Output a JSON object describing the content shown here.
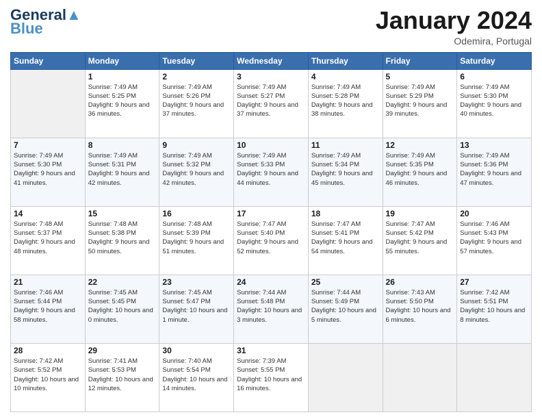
{
  "header": {
    "logo_general": "General",
    "logo_blue": "Blue",
    "month_title": "January 2024",
    "location": "Odemira, Portugal"
  },
  "days_of_week": [
    "Sunday",
    "Monday",
    "Tuesday",
    "Wednesday",
    "Thursday",
    "Friday",
    "Saturday"
  ],
  "weeks": [
    [
      {
        "day": "",
        "sunrise": "",
        "sunset": "",
        "daylight": ""
      },
      {
        "day": "1",
        "sunrise": "Sunrise: 7:49 AM",
        "sunset": "Sunset: 5:25 PM",
        "daylight": "Daylight: 9 hours and 36 minutes."
      },
      {
        "day": "2",
        "sunrise": "Sunrise: 7:49 AM",
        "sunset": "Sunset: 5:26 PM",
        "daylight": "Daylight: 9 hours and 37 minutes."
      },
      {
        "day": "3",
        "sunrise": "Sunrise: 7:49 AM",
        "sunset": "Sunset: 5:27 PM",
        "daylight": "Daylight: 9 hours and 37 minutes."
      },
      {
        "day": "4",
        "sunrise": "Sunrise: 7:49 AM",
        "sunset": "Sunset: 5:28 PM",
        "daylight": "Daylight: 9 hours and 38 minutes."
      },
      {
        "day": "5",
        "sunrise": "Sunrise: 7:49 AM",
        "sunset": "Sunset: 5:29 PM",
        "daylight": "Daylight: 9 hours and 39 minutes."
      },
      {
        "day": "6",
        "sunrise": "Sunrise: 7:49 AM",
        "sunset": "Sunset: 5:30 PM",
        "daylight": "Daylight: 9 hours and 40 minutes."
      }
    ],
    [
      {
        "day": "7",
        "sunrise": "Sunrise: 7:49 AM",
        "sunset": "Sunset: 5:30 PM",
        "daylight": "Daylight: 9 hours and 41 minutes."
      },
      {
        "day": "8",
        "sunrise": "Sunrise: 7:49 AM",
        "sunset": "Sunset: 5:31 PM",
        "daylight": "Daylight: 9 hours and 42 minutes."
      },
      {
        "day": "9",
        "sunrise": "Sunrise: 7:49 AM",
        "sunset": "Sunset: 5:32 PM",
        "daylight": "Daylight: 9 hours and 42 minutes."
      },
      {
        "day": "10",
        "sunrise": "Sunrise: 7:49 AM",
        "sunset": "Sunset: 5:33 PM",
        "daylight": "Daylight: 9 hours and 44 minutes."
      },
      {
        "day": "11",
        "sunrise": "Sunrise: 7:49 AM",
        "sunset": "Sunset: 5:34 PM",
        "daylight": "Daylight: 9 hours and 45 minutes."
      },
      {
        "day": "12",
        "sunrise": "Sunrise: 7:49 AM",
        "sunset": "Sunset: 5:35 PM",
        "daylight": "Daylight: 9 hours and 46 minutes."
      },
      {
        "day": "13",
        "sunrise": "Sunrise: 7:49 AM",
        "sunset": "Sunset: 5:36 PM",
        "daylight": "Daylight: 9 hours and 47 minutes."
      }
    ],
    [
      {
        "day": "14",
        "sunrise": "Sunrise: 7:48 AM",
        "sunset": "Sunset: 5:37 PM",
        "daylight": "Daylight: 9 hours and 48 minutes."
      },
      {
        "day": "15",
        "sunrise": "Sunrise: 7:48 AM",
        "sunset": "Sunset: 5:38 PM",
        "daylight": "Daylight: 9 hours and 50 minutes."
      },
      {
        "day": "16",
        "sunrise": "Sunrise: 7:48 AM",
        "sunset": "Sunset: 5:39 PM",
        "daylight": "Daylight: 9 hours and 51 minutes."
      },
      {
        "day": "17",
        "sunrise": "Sunrise: 7:47 AM",
        "sunset": "Sunset: 5:40 PM",
        "daylight": "Daylight: 9 hours and 52 minutes."
      },
      {
        "day": "18",
        "sunrise": "Sunrise: 7:47 AM",
        "sunset": "Sunset: 5:41 PM",
        "daylight": "Daylight: 9 hours and 54 minutes."
      },
      {
        "day": "19",
        "sunrise": "Sunrise: 7:47 AM",
        "sunset": "Sunset: 5:42 PM",
        "daylight": "Daylight: 9 hours and 55 minutes."
      },
      {
        "day": "20",
        "sunrise": "Sunrise: 7:46 AM",
        "sunset": "Sunset: 5:43 PM",
        "daylight": "Daylight: 9 hours and 57 minutes."
      }
    ],
    [
      {
        "day": "21",
        "sunrise": "Sunrise: 7:46 AM",
        "sunset": "Sunset: 5:44 PM",
        "daylight": "Daylight: 9 hours and 58 minutes."
      },
      {
        "day": "22",
        "sunrise": "Sunrise: 7:45 AM",
        "sunset": "Sunset: 5:45 PM",
        "daylight": "Daylight: 10 hours and 0 minutes."
      },
      {
        "day": "23",
        "sunrise": "Sunrise: 7:45 AM",
        "sunset": "Sunset: 5:47 PM",
        "daylight": "Daylight: 10 hours and 1 minute."
      },
      {
        "day": "24",
        "sunrise": "Sunrise: 7:44 AM",
        "sunset": "Sunset: 5:48 PM",
        "daylight": "Daylight: 10 hours and 3 minutes."
      },
      {
        "day": "25",
        "sunrise": "Sunrise: 7:44 AM",
        "sunset": "Sunset: 5:49 PM",
        "daylight": "Daylight: 10 hours and 5 minutes."
      },
      {
        "day": "26",
        "sunrise": "Sunrise: 7:43 AM",
        "sunset": "Sunset: 5:50 PM",
        "daylight": "Daylight: 10 hours and 6 minutes."
      },
      {
        "day": "27",
        "sunrise": "Sunrise: 7:42 AM",
        "sunset": "Sunset: 5:51 PM",
        "daylight": "Daylight: 10 hours and 8 minutes."
      }
    ],
    [
      {
        "day": "28",
        "sunrise": "Sunrise: 7:42 AM",
        "sunset": "Sunset: 5:52 PM",
        "daylight": "Daylight: 10 hours and 10 minutes."
      },
      {
        "day": "29",
        "sunrise": "Sunrise: 7:41 AM",
        "sunset": "Sunset: 5:53 PM",
        "daylight": "Daylight: 10 hours and 12 minutes."
      },
      {
        "day": "30",
        "sunrise": "Sunrise: 7:40 AM",
        "sunset": "Sunset: 5:54 PM",
        "daylight": "Daylight: 10 hours and 14 minutes."
      },
      {
        "day": "31",
        "sunrise": "Sunrise: 7:39 AM",
        "sunset": "Sunset: 5:55 PM",
        "daylight": "Daylight: 10 hours and 16 minutes."
      },
      {
        "day": "",
        "sunrise": "",
        "sunset": "",
        "daylight": ""
      },
      {
        "day": "",
        "sunrise": "",
        "sunset": "",
        "daylight": ""
      },
      {
        "day": "",
        "sunrise": "",
        "sunset": "",
        "daylight": ""
      }
    ]
  ]
}
